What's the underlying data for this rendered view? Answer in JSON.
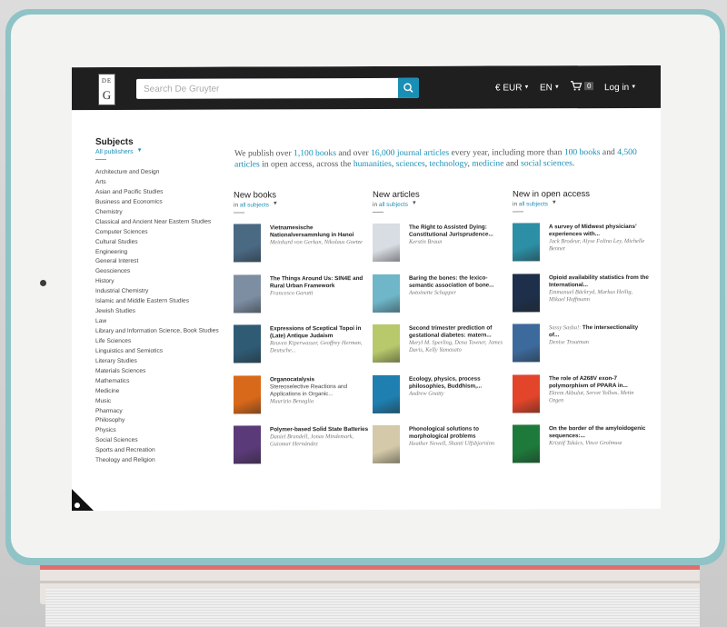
{
  "header": {
    "logo_top": "DE",
    "logo_letter": "G",
    "search_placeholder": "Search De Gruyter",
    "currency": "€ EUR",
    "language": "EN",
    "cart_count": "0",
    "login": "Log in"
  },
  "sidebar": {
    "title": "Subjects",
    "filter": "All publishers",
    "items": [
      "Architecture and Design",
      "Arts",
      "Asian and Pacific Studies",
      "Business and Economics",
      "Chemistry",
      "Classical and Ancient Near Eastern Studies",
      "Computer Sciences",
      "Cultural Studies",
      "Engineering",
      "General Interest",
      "Geosciences",
      "History",
      "Industrial Chemistry",
      "Islamic and Middle Eastern Studies",
      "Jewish Studies",
      "Law",
      "Library and Information Science, Book Studies",
      "Life Sciences",
      "Linguistics and Semiotics",
      "Literary Studies",
      "Materials Sciences",
      "Mathematics",
      "Medicine",
      "Music",
      "Pharmacy",
      "Philosophy",
      "Physics",
      "Social Sciences",
      "Sports and Recreation",
      "Theology and Religion"
    ]
  },
  "intro": {
    "p1": "We publish over ",
    "books": "1,100 books",
    "p2": " and over ",
    "journals": "16,000 journal articles",
    "p3": " every year, including more than ",
    "oa_books": "100 books",
    "p4": " and ",
    "oa_articles": "4,500 articles",
    "p5": " in open access, across the ",
    "s1": "humanities",
    "c1": ", ",
    "s2": "sciences",
    "c2": ", ",
    "s3": "technology",
    "c3": ", ",
    "s4": "medicine",
    "c4": " and ",
    "s5": "social sciences",
    "end": "."
  },
  "columns": [
    {
      "title": "New books",
      "filter_prefix": "in ",
      "filter": "all subjects",
      "items": [
        {
          "title": "Vietnamesische Nationalversammlung in Hanoi",
          "authors": "Meinhard von Gerkan, Nikolaus Goetze",
          "color": "#4a6a84"
        },
        {
          "title": "The Things Around Us: SIN4E and Rural Urban Framework",
          "authors": "Francesco Garutti",
          "color": "#7d8ea3"
        },
        {
          "title": "Expressions of Sceptical Topoi in (Late) Antique Judaism",
          "authors": "Reuven Kiperwasser, Geoffrey Herman, Deutsche...",
          "color": "#2f5b75"
        },
        {
          "title": "Organocatalysis",
          "subtitle": "Stereoselective Reactions and Applications in Organic...",
          "authors": "Maurizio Benaglia",
          "color": "#d9691a"
        },
        {
          "title": "Polymer-based Solid State Batteries",
          "authors": "Daniel Brandell, Jonas Mindemark, Guiomar Hernández",
          "color": "#5a3a78"
        }
      ]
    },
    {
      "title": "New articles",
      "filter_prefix": "in ",
      "filter": "all subjects",
      "items": [
        {
          "title": "The Right to Assisted Dying: Constitutional Jurisprudence...",
          "authors": "Kerstin Braun",
          "color": "#d8dde3"
        },
        {
          "title": "Baring the bones: the lexico-semantic association of bone...",
          "authors": "Antoinette Schapper",
          "color": "#6fb6c9"
        },
        {
          "title": "Second trimester prediction of gestational diabetes: matern...",
          "authors": "Meryl M. Sperling, Dena Towner, James Davis, Kelly Yamasato",
          "color": "#b8c96c"
        },
        {
          "title": "Ecology, physics, process philosophies, Buddhism,...",
          "authors": "Andrew Gnatty",
          "color": "#1f7fb0"
        },
        {
          "title": "Phonological solutions to morphological problems",
          "authors": "Heather Newell, Shanti Ulfsbjorninn",
          "color": "#d4c9a8"
        }
      ]
    },
    {
      "title": "New in open access",
      "filter_prefix": "in ",
      "filter": "all subjects",
      "items": [
        {
          "title": "A survey of Midwest physicians’ experiences with...",
          "authors": "Jack Brodeur, Alyse Folino Ley, Michelle Bennet",
          "color": "#2c8fa6"
        },
        {
          "title": "Opioid availability statistics from the International...",
          "authors": "Emmanuel Bäckryd, Markus Heilig, Mikael Hoffmann",
          "color": "#1d2f4a"
        },
        {
          "title": "The intersectionality of...",
          "authors_prefix": "Sassy Sasha!: ",
          "authors": "Denise Troutman",
          "color": "#3d6a9c"
        },
        {
          "title": "The role of A268V exon-7 polymorphism of PPARA in...",
          "authors": "Ekrem Akbulut, Servet Yolbas, Metin Ozgen",
          "color": "#e2452a"
        },
        {
          "title": "On the border of the amyloidogenic sequences:...",
          "authors": "Kristóf Takács, Vince Grolmusz",
          "color": "#1e7a3b"
        }
      ]
    }
  ]
}
